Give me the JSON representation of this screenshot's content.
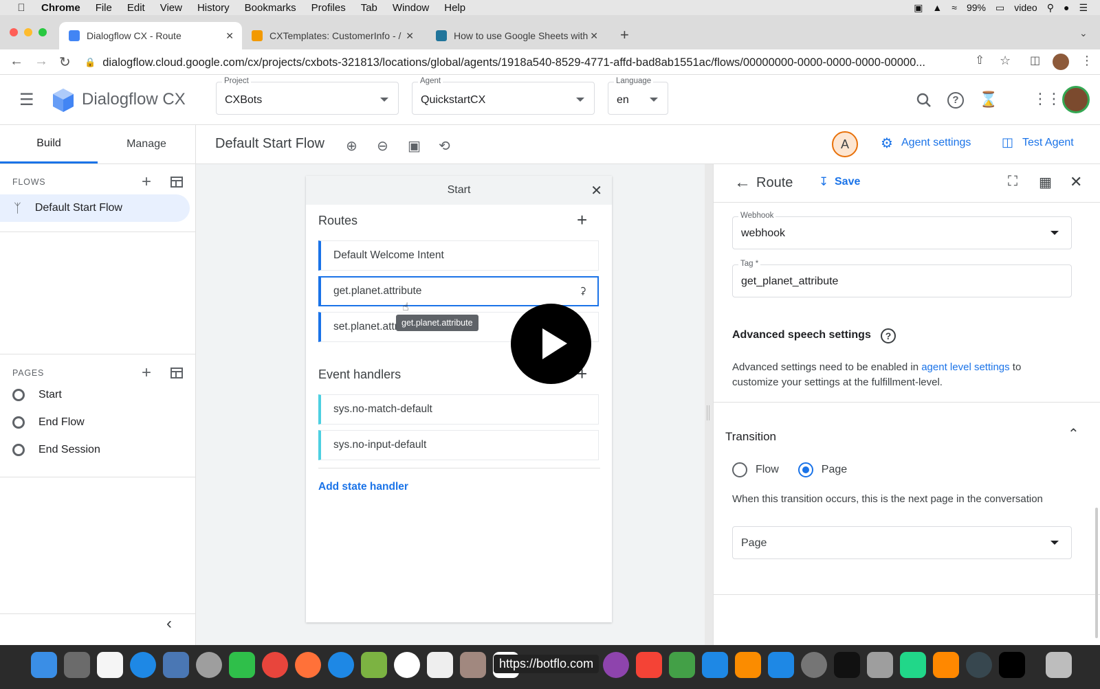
{
  "menubar": {
    "items": [
      "Chrome",
      "File",
      "Edit",
      "View",
      "History",
      "Bookmarks",
      "Profiles",
      "Tab",
      "Window",
      "Help"
    ],
    "battery": "99%",
    "user": "video"
  },
  "tabs": [
    {
      "title": "Dialogflow CX - Route"
    },
    {
      "title": "CXTemplates: CustomerInfo - /"
    },
    {
      "title": "How to use Google Sheets with"
    }
  ],
  "address": {
    "url": "dialogflow.cloud.google.com/cx/projects/cxbots-321813/locations/global/agents/1918a540-8529-4771-affd-bad8ab1551ac/flows/00000000-0000-0000-0000-00000..."
  },
  "app": {
    "title": "Dialogflow CX",
    "project_label": "Project",
    "project_value": "CXBots",
    "agent_label": "Agent",
    "agent_value": "QuickstartCX",
    "language_label": "Language",
    "language_value": "en"
  },
  "left": {
    "tab_build": "Build",
    "tab_manage": "Manage",
    "flows_heading": "FLOWS",
    "flows": [
      "Default Start Flow"
    ],
    "pages_heading": "PAGES",
    "pages": [
      "Start",
      "End Flow",
      "End Session"
    ]
  },
  "canvas": {
    "title": "Default Start Flow",
    "avatar_letter": "A",
    "agent_settings": "Agent settings",
    "test_agent": "Test Agent",
    "card": {
      "title": "Start",
      "routes_heading": "Routes",
      "routes": [
        "Default Welcome Intent",
        "get.planet.attribute",
        "set.planet.attribute"
      ],
      "tooltip": "get.planet.attribute",
      "event_heading": "Event handlers",
      "events": [
        "sys.no-match-default",
        "sys.no-input-default"
      ],
      "add_state": "Add state handler"
    }
  },
  "route_panel": {
    "title": "Route",
    "save": "Save",
    "webhook_label": "Webhook",
    "webhook_value": "webhook",
    "tag_label": "Tag *",
    "tag_value": "get_planet_attribute",
    "adv_heading": "Advanced speech settings",
    "adv_text_1": "Advanced settings need to be enabled in ",
    "adv_link": "agent level settings",
    "adv_text_2": " to",
    "adv_text_3": "customize your settings at the fulfillment-level.",
    "transition_heading": "Transition",
    "radio_flow": "Flow",
    "radio_page": "Page",
    "transition_desc": "When this transition occurs, this is the next page in the conversation",
    "page_select": "Page"
  },
  "dock": {
    "url_overlay": "https://botflo.com"
  },
  "colors": {
    "accent": "#1a73e8",
    "event_bar": "#4dd0e1"
  }
}
